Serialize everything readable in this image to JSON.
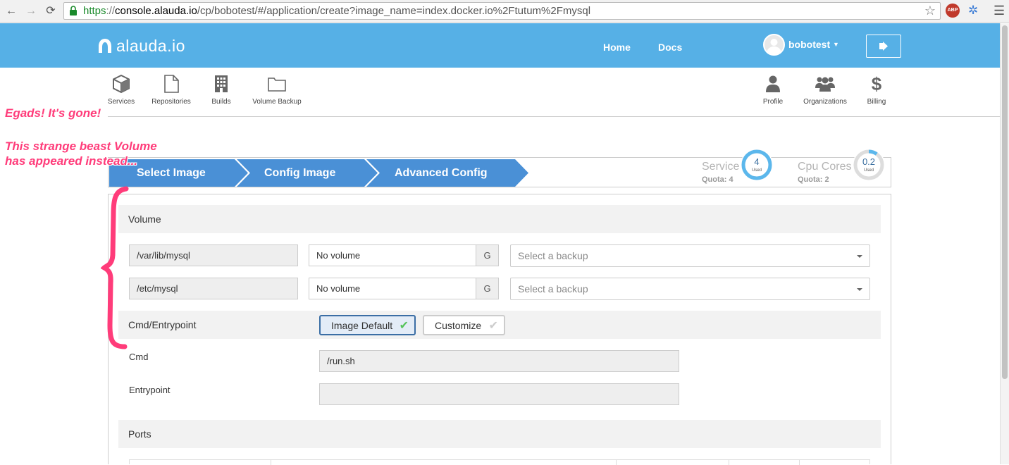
{
  "browser": {
    "url_scheme": "https",
    "url_host": "console.alauda.io",
    "url_path": "/cp/bobotest/#/application/create?image_name=index.docker.io%2Ftutum%2Fmysql",
    "abp_label": "ABP"
  },
  "header": {
    "logo_text": "alauda.io",
    "links": [
      "Home",
      "Docs"
    ],
    "username": "bobotest",
    "bg_color": "#56b0e6"
  },
  "subnav": {
    "left": [
      {
        "label": "Services",
        "icon": "cube-icon"
      },
      {
        "label": "Repositories",
        "icon": "file-icon"
      },
      {
        "label": "Builds",
        "icon": "building-icon"
      },
      {
        "label": "Volume Backup",
        "icon": "folder-icon"
      }
    ],
    "right": [
      {
        "label": "Profile",
        "icon": "user-icon"
      },
      {
        "label": "Organizations",
        "icon": "users-icon"
      },
      {
        "label": "Billing",
        "icon": "dollar-icon"
      }
    ]
  },
  "steps": {
    "items": [
      "Select Image",
      "Config Image",
      "Advanced Config"
    ],
    "color": "#4a90d6"
  },
  "quota": {
    "service": {
      "title": "Service",
      "sub": "Quota:  4",
      "value": "4",
      "used": "Used",
      "fraction": 1.0
    },
    "cpu": {
      "title": "Cpu Cores",
      "sub": "Quota:  2",
      "value": "0.2",
      "used": "Used",
      "fraction": 0.1
    }
  },
  "volume": {
    "title": "Volume",
    "rows": [
      {
        "path": "/var/lib/mysql",
        "size": "No volume",
        "unit": "G",
        "backup_placeholder": "Select a backup"
      },
      {
        "path": "/etc/mysql",
        "size": "No volume",
        "unit": "G",
        "backup_placeholder": "Select a backup"
      }
    ]
  },
  "cmd_entrypoint": {
    "title": "Cmd/Entrypoint",
    "toggle_default": "Image Default",
    "toggle_custom": "Customize",
    "cmd_label": "Cmd",
    "cmd_value": "/run.sh",
    "entrypoint_label": "Entrypoint",
    "entrypoint_value": ""
  },
  "ports": {
    "title": "Ports"
  },
  "annotations": {
    "line1": "Egads! It's gone!",
    "line2": "This strange beast Volume",
    "line3": "has appeared instead...",
    "color": "#ff3c7a"
  }
}
